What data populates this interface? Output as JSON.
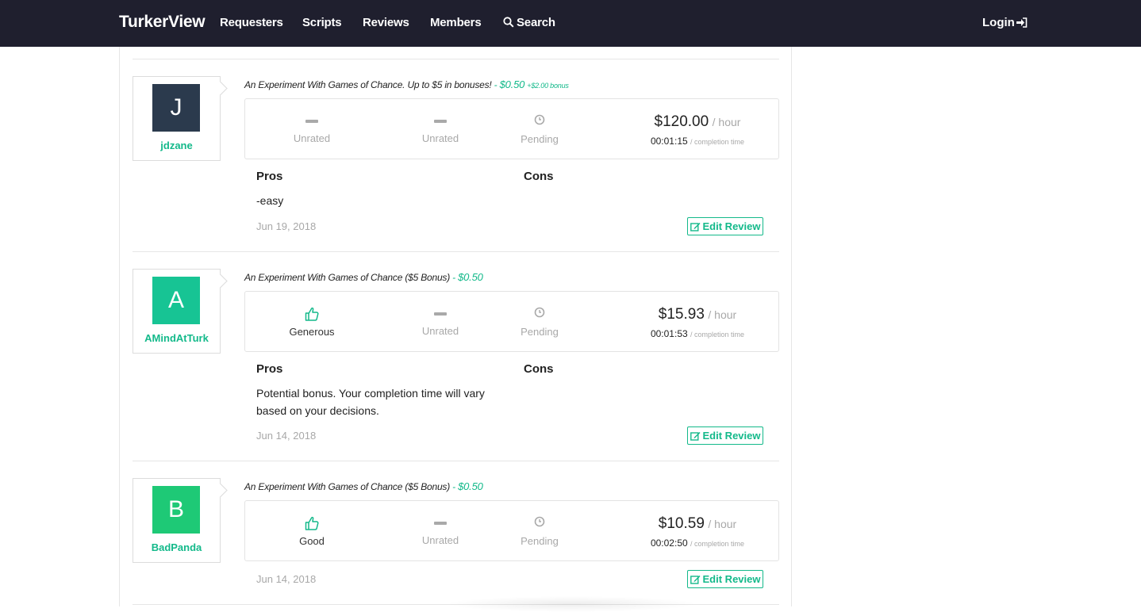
{
  "nav": {
    "brand": "TurkerView",
    "links": [
      "Requesters",
      "Scripts",
      "Reviews",
      "Members",
      "Search"
    ],
    "login": "Login"
  },
  "colors": {
    "navbar": "#1f1f2e",
    "accent": "#13b98a",
    "avatar_j": "#2b3a4d",
    "avatar_a": "#17c494",
    "avatar_b": "#1ec976"
  },
  "reviews": [
    {
      "initial": "J",
      "username": "jdzane",
      "hit_title": "An Experiment With Games of Chance. Up to $5 in bonuses!",
      "separator": "-",
      "pay": "$0.50",
      "bonus": "+$2.00 bonus",
      "ratings": [
        {
          "icon": "dash-icon",
          "label": "Unrated"
        },
        {
          "icon": "dash-icon",
          "label": "Unrated"
        },
        {
          "icon": "clock-icon",
          "label": "Pending"
        }
      ],
      "hourly": "$120.00",
      "hourly_unit": "/ hour",
      "completion_time": "00:01:15",
      "completion_unit": "/ completion time",
      "pros_label": "Pros",
      "cons_label": "Cons",
      "pros": "-easy",
      "date": "Jun 19, 2018",
      "edit_label": "Edit Review"
    },
    {
      "initial": "A",
      "username": "AMindAtTurk",
      "hit_title": "An Experiment With Games of Chance ($5 Bonus)",
      "separator": "-",
      "pay": "$0.50",
      "ratings": [
        {
          "icon": "thumbs-up-icon",
          "label": "Generous"
        },
        {
          "icon": "dash-icon",
          "label": "Unrated"
        },
        {
          "icon": "clock-icon",
          "label": "Pending"
        }
      ],
      "hourly": "$15.93",
      "hourly_unit": "/ hour",
      "completion_time": "00:01:53",
      "completion_unit": "/ completion time",
      "pros_label": "Pros",
      "cons_label": "Cons",
      "pros": "Potential bonus. Your completion time will vary based on your decisions.",
      "date": "Jun 14, 2018",
      "edit_label": "Edit Review"
    },
    {
      "initial": "B",
      "username": "BadPanda",
      "hit_title": "An Experiment With Games of Chance ($5 Bonus)",
      "separator": "-",
      "pay": "$0.50",
      "ratings": [
        {
          "icon": "thumbs-up-icon",
          "label": "Good"
        },
        {
          "icon": "dash-icon",
          "label": "Unrated"
        },
        {
          "icon": "clock-icon",
          "label": "Pending"
        }
      ],
      "hourly": "$10.59",
      "hourly_unit": "/ hour",
      "completion_time": "00:02:50",
      "completion_unit": "/ completion time",
      "date": "Jun 14, 2018",
      "edit_label": "Edit Review"
    }
  ]
}
